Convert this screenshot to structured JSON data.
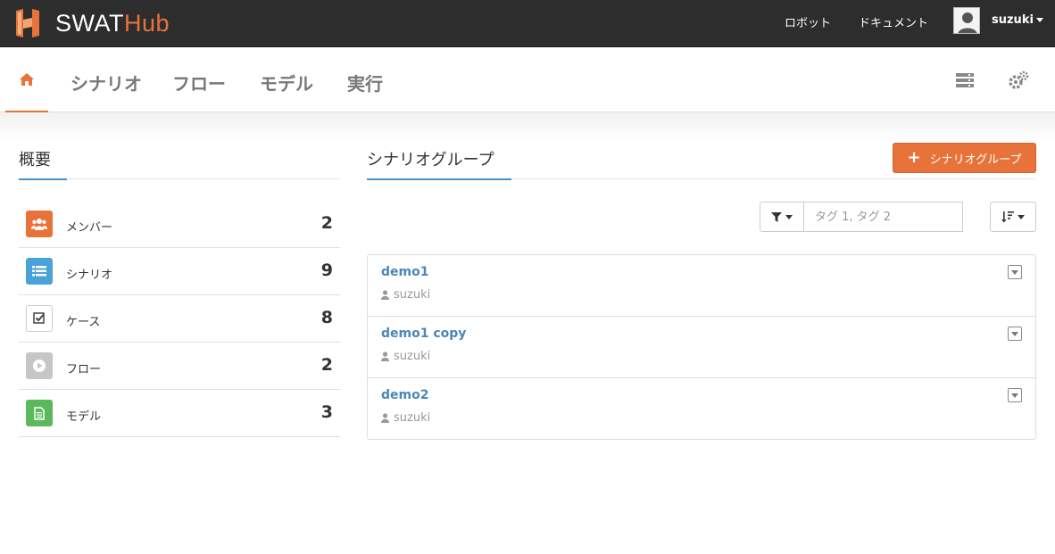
{
  "brand": {
    "part1": "SWAT",
    "part2": "Hub",
    "accent": "#e8733a"
  },
  "topnav": {
    "links": [
      "ロボット",
      "ドキュメント"
    ],
    "user": "suzuki"
  },
  "subnav": {
    "home_icon": "home-icon",
    "tabs": [
      "シナリオ",
      "フロー",
      "モデル",
      "実行"
    ],
    "right_icons": [
      "server-icon",
      "gears-icon"
    ]
  },
  "overview": {
    "title": "概要",
    "stats": [
      {
        "label": "メンバー",
        "value": "2",
        "icon": "users-icon",
        "color": "#e8733a"
      },
      {
        "label": "シナリオ",
        "value": "9",
        "icon": "list-icon",
        "color": "#4aa3d8"
      },
      {
        "label": "ケース",
        "value": "8",
        "icon": "check-square-icon",
        "color": "#ffffff"
      },
      {
        "label": "フロー",
        "value": "2",
        "icon": "play-circle-icon",
        "color": "#c6c6c6"
      },
      {
        "label": "モデル",
        "value": "3",
        "icon": "file-icon",
        "color": "#5cb85c"
      }
    ]
  },
  "scenario_groups": {
    "title": "シナリオグループ",
    "add_button": "シナリオグループ",
    "tag_placeholder": "タグ 1, タグ 2",
    "items": [
      {
        "name": "demo1",
        "owner": "suzuki"
      },
      {
        "name": "demo1 copy",
        "owner": "suzuki"
      },
      {
        "name": "demo2",
        "owner": "suzuki"
      }
    ]
  }
}
